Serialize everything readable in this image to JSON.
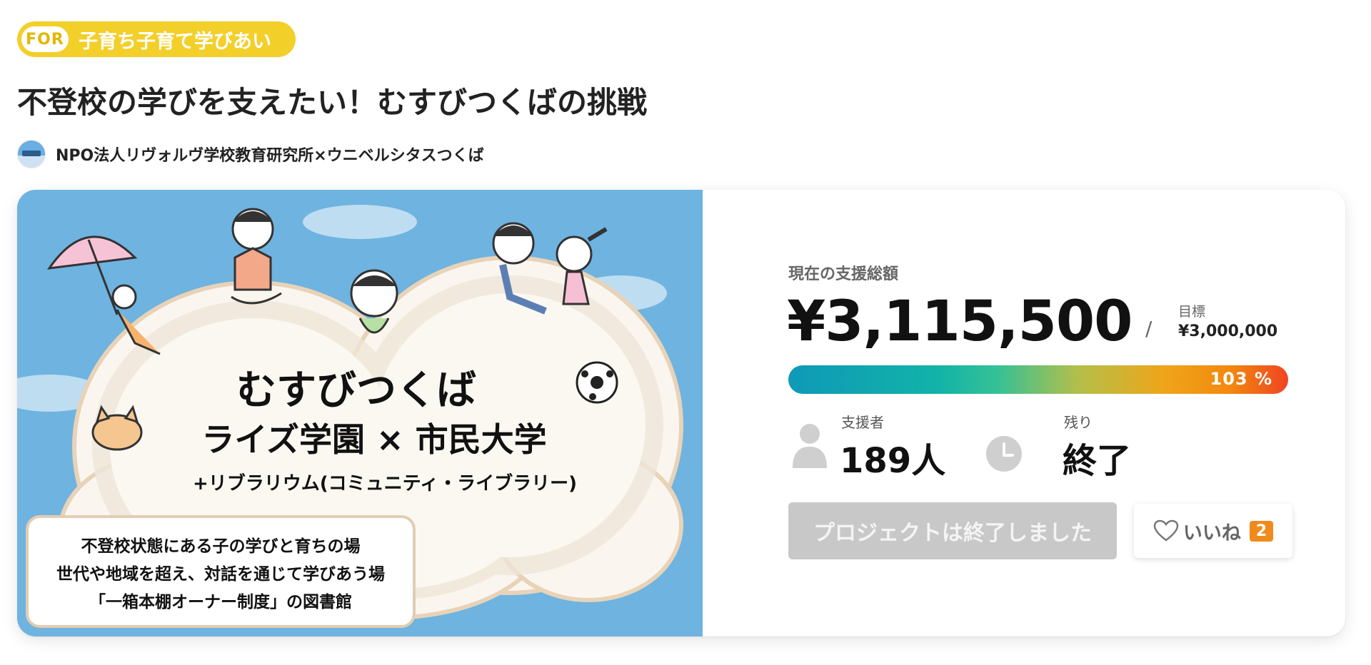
{
  "category": {
    "prefix": "FOR",
    "label": "子育ち子育て学びあい"
  },
  "project": {
    "title": "不登校の学びを支えたい！むすびつくばの挑戦",
    "owner": "NPO法人リヴォルヴ学校教育研究所×ウニベルシタスつくば"
  },
  "hero": {
    "headline": "むすびつくば",
    "subhead": "ライズ学園 × 市民大学",
    "tagline": "+リブラリウム(コミュニティ・ライブラリー)",
    "description_lines": [
      "不登校状態にある子の学びと育ちの場",
      "世代や地域を超え、対話を通じて学びあう場",
      "「一箱本棚オーナー制度」の図書館"
    ]
  },
  "funding": {
    "total_label": "現在の支援総額",
    "total_amount": "¥3,115,500",
    "separator": "/",
    "goal_label": "目標",
    "goal_amount": "¥3,000,000",
    "progress_text": "103 %",
    "progress_percent": 103
  },
  "stats": {
    "backers_label": "支援者",
    "backers_value": "189人",
    "remaining_label": "残り",
    "remaining_value": "終了"
  },
  "actions": {
    "ended_label": "プロジェクトは終了しました",
    "like_label": "いいね",
    "like_count": "2"
  },
  "colors": {
    "badge": "#f3cf2a",
    "hero_sky": "#6fb3e0",
    "progress_start": "#0f99b8",
    "progress_end": "#ef4422",
    "like_badge": "#f08a1c",
    "disabled_button": "#c8c8c8"
  },
  "icons": {
    "backers": "person-icon",
    "remaining": "clock-icon",
    "like": "heart-icon"
  }
}
